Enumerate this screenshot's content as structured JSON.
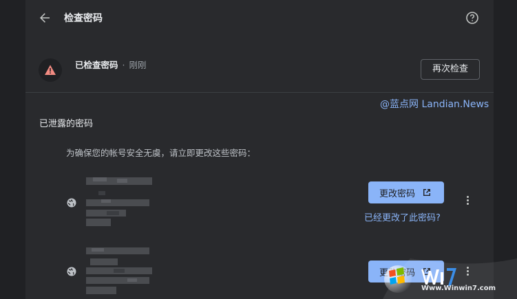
{
  "header": {
    "title": "检查密码",
    "back_icon": "arrow-back-icon",
    "help_icon": "help-circle-icon"
  },
  "check": {
    "status_main": "已检查密码",
    "status_separator": "·",
    "status_time": "刚刚",
    "recheck_label": "再次检查",
    "warning_icon": "warning-triangle-icon",
    "warning_color": "#f28b82"
  },
  "watermark": "@蓝点网 Landian.News",
  "section": {
    "title": "已泄露的密码",
    "instruction": "为确保您的帐号安全无虞，请立即更改这些密码："
  },
  "credentials": [
    {
      "change_label": "更改密码",
      "already_changed_link": "已经更改了此密码?"
    },
    {
      "change_label": "更改密码"
    }
  ],
  "footer_watermark": {
    "text": "Www.Winwin7.com"
  },
  "colors": {
    "accent": "#8ab4f8",
    "background": "#202124",
    "panel": "#292a2d"
  }
}
